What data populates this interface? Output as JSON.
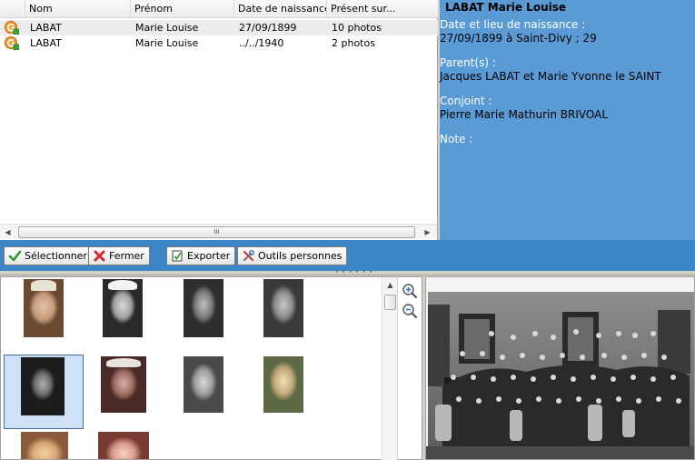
{
  "list": {
    "columns": [
      "Nom",
      "Prénom",
      "Date de naissance",
      "Présent sur..."
    ],
    "rows": [
      {
        "nom": "LABAT",
        "prenom": "Marie Louise",
        "date": "27/09/1899",
        "present": "10 photos",
        "selected": true
      },
      {
        "nom": "LABAT",
        "prenom": "Marie Louise",
        "date": "../../1940",
        "present": "2 photos",
        "selected": false
      }
    ],
    "scroll_grip": "III"
  },
  "info": {
    "title": "LABAT Marie Louise",
    "birth_label": "Date et lieu de naissance :",
    "birth_value": "27/09/1899 à Saint-Divy ; 29",
    "parents_label": "Parent(s) :",
    "parents_value": "Jacques LABAT et Marie Yvonne le SAINT",
    "spouse_label": "Conjoint :",
    "spouse_value": "Pierre Marie Mathurin BRIVOAL",
    "note_label": "Note :"
  },
  "toolbar": {
    "select_label": "Sélectionner",
    "close_label": "Fermer",
    "export_label": "Exporter",
    "tools_label": "Outils personnes"
  },
  "colors": {
    "info_panel": "#5b9bd5",
    "toolbar": "#3c85c7",
    "selection": "#cfe1f6"
  }
}
